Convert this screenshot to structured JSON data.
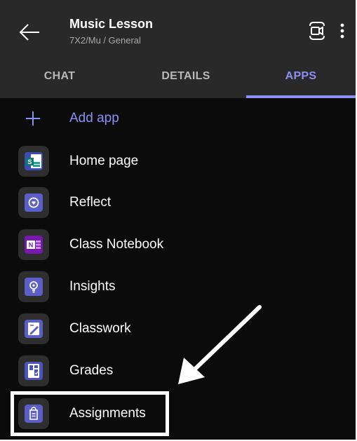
{
  "header": {
    "title": "Music Lesson",
    "subtitle": "7X2/Mu / General",
    "back_icon": "arrow-left-icon",
    "meet_icon": "video-call-icon",
    "more_icon": "more-vertical-icon"
  },
  "tabs": [
    {
      "label": "CHAT",
      "active": false
    },
    {
      "label": "DETAILS",
      "active": false
    },
    {
      "label": "APPS",
      "active": true
    }
  ],
  "colors": {
    "accent": "#8b8ff5",
    "header_bg": "#292929",
    "body_bg": "#0b0b0b"
  },
  "apps": {
    "add_label": "Add app",
    "items": [
      {
        "label": "Home page",
        "icon": "sharepoint-icon"
      },
      {
        "label": "Reflect",
        "icon": "reflect-icon"
      },
      {
        "label": "Class Notebook",
        "icon": "onenote-icon"
      },
      {
        "label": "Insights",
        "icon": "insights-icon"
      },
      {
        "label": "Classwork",
        "icon": "classwork-icon"
      },
      {
        "label": "Grades",
        "icon": "grades-icon"
      },
      {
        "label": "Assignments",
        "icon": "assignments-icon"
      }
    ]
  },
  "annotation": {
    "arrow_icon": "pointer-arrow-icon",
    "highlighted_item": "Assignments"
  }
}
